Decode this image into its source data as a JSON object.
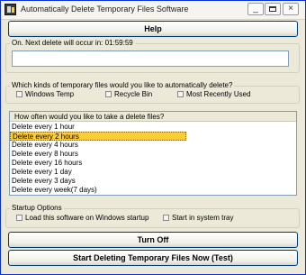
{
  "window": {
    "title": "Automatically Delete Temporary Files Software",
    "minimize_glyph": "_",
    "close_glyph": "×",
    "app_icon": "app-icon"
  },
  "help_button": {
    "label": "Help"
  },
  "next_delete": {
    "label": "On. Next delete will occur in: 01:59:59",
    "value": ""
  },
  "kinds": {
    "label": "Which kinds of temporary files would you like to automatically delete?",
    "options": [
      {
        "label": "Windows Temp",
        "checked": false
      },
      {
        "label": "Recycle Bin",
        "checked": false
      },
      {
        "label": "Most Recently Used",
        "checked": false
      }
    ]
  },
  "frequency": {
    "header": "How often would you like to take a delete files?",
    "selected_index": 1,
    "items": [
      "Delete every 1 hour",
      "Delete every 2 hours",
      "Delete every 4 hours",
      "Delete every 8 hours",
      "Delete every 16 hours",
      "Delete every 1 day",
      "Delete every 3 days",
      "Delete every week(7 days)"
    ]
  },
  "startup": {
    "label": "Startup Options",
    "options": [
      {
        "label": "Load this software on Windows startup",
        "checked": false
      },
      {
        "label": "Start in system tray",
        "checked": false
      }
    ]
  },
  "turn_off_button": {
    "label": "Turn Off"
  },
  "start_button": {
    "label": "Start Deleting Temporary Files Now (Test)"
  },
  "colors": {
    "selection": "#ffcc33",
    "window_bg": "#ece9d8",
    "frame": "#0831d9"
  }
}
